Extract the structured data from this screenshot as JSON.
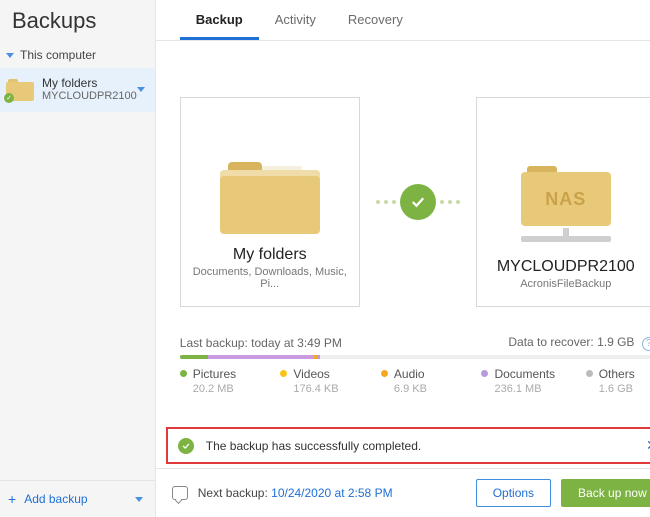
{
  "sidebar": {
    "title": "Backups",
    "tree_header": "This computer",
    "item": {
      "name": "My folders",
      "dest": "MYCLOUDPR2100"
    },
    "add": "Add backup"
  },
  "tabs": {
    "backup": "Backup",
    "activity": "Activity",
    "recovery": "Recovery"
  },
  "source": {
    "title": "My folders",
    "sub": "Documents, Downloads, Music, Pi..."
  },
  "target": {
    "title": "MYCLOUDPR2100",
    "sub": "AcronisFileBackup",
    "nas_label": "NAS"
  },
  "meta": {
    "last_backup": "Last backup: today at 3:49 PM",
    "recover": "Data to recover: 1.9 GB"
  },
  "cats": {
    "pictures": {
      "label": "Pictures",
      "size": "20.2 MB"
    },
    "videos": {
      "label": "Videos",
      "size": "176.4 KB"
    },
    "audio": {
      "label": "Audio",
      "size": "6.9 KB"
    },
    "documents": {
      "label": "Documents",
      "size": "236.1 MB"
    },
    "others": {
      "label": "Others",
      "size": "1.6 GB"
    }
  },
  "alert": {
    "text": "The backup has successfully completed."
  },
  "footer": {
    "next_label": "Next backup: ",
    "next_time": "10/24/2020 at 2:58 PM",
    "options": "Options",
    "run": "Back up now"
  }
}
